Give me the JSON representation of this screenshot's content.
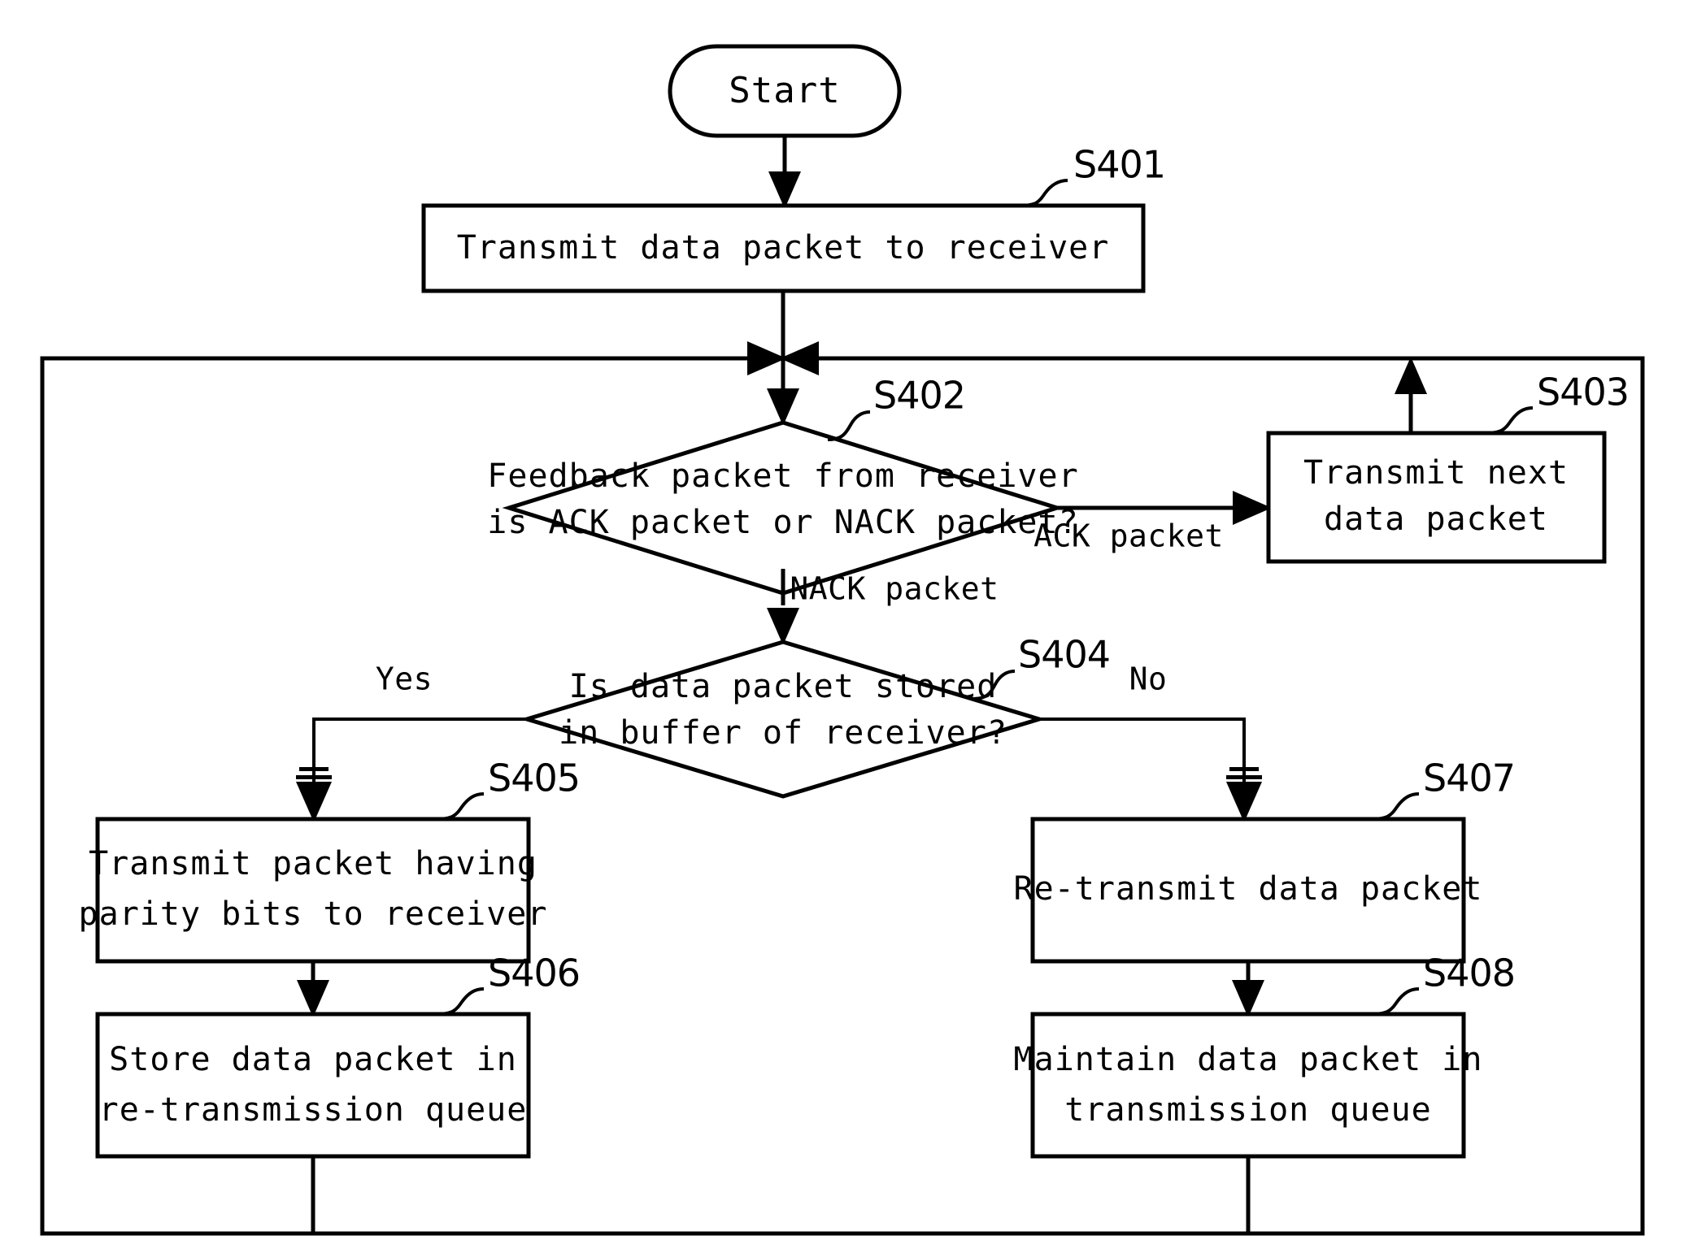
{
  "figure": {
    "type": "patent-flowchart",
    "background_color": "#ffffff",
    "line_color": "#000000"
  },
  "nodes": {
    "start": {
      "label": "Start",
      "shape": "stadium"
    },
    "s401": {
      "ref": "S401",
      "line1": "Transmit data packet to receiver",
      "shape": "rectangle"
    },
    "s402": {
      "ref": "S402",
      "line1": "Feedback packet from receiver",
      "line2": "is ACK packet or NACK packet?",
      "shape": "diamond"
    },
    "s403": {
      "ref": "S403",
      "line1": "Transmit next",
      "line2": "data packet",
      "shape": "rectangle"
    },
    "s404": {
      "ref": "S404",
      "line1": "Is data packet stored",
      "line2": "in buffer of receiver?",
      "shape": "diamond"
    },
    "s405": {
      "ref": "S405",
      "line1": "Transmit packet having",
      "line2": "parity bits to receiver",
      "shape": "rectangle"
    },
    "s406": {
      "ref": "S406",
      "line1": "Store data packet in",
      "line2": "re-transmission queue",
      "shape": "rectangle"
    },
    "s407": {
      "ref": "S407",
      "line1": "Re-transmit data packet",
      "shape": "rectangle"
    },
    "s408": {
      "ref": "S408",
      "line1": "Maintain data packet in",
      "line2": "transmission queue",
      "shape": "rectangle"
    }
  },
  "edge_labels": {
    "ack": "ACK packet",
    "nack": "NACK packet",
    "yes": "Yes",
    "no": "No"
  }
}
